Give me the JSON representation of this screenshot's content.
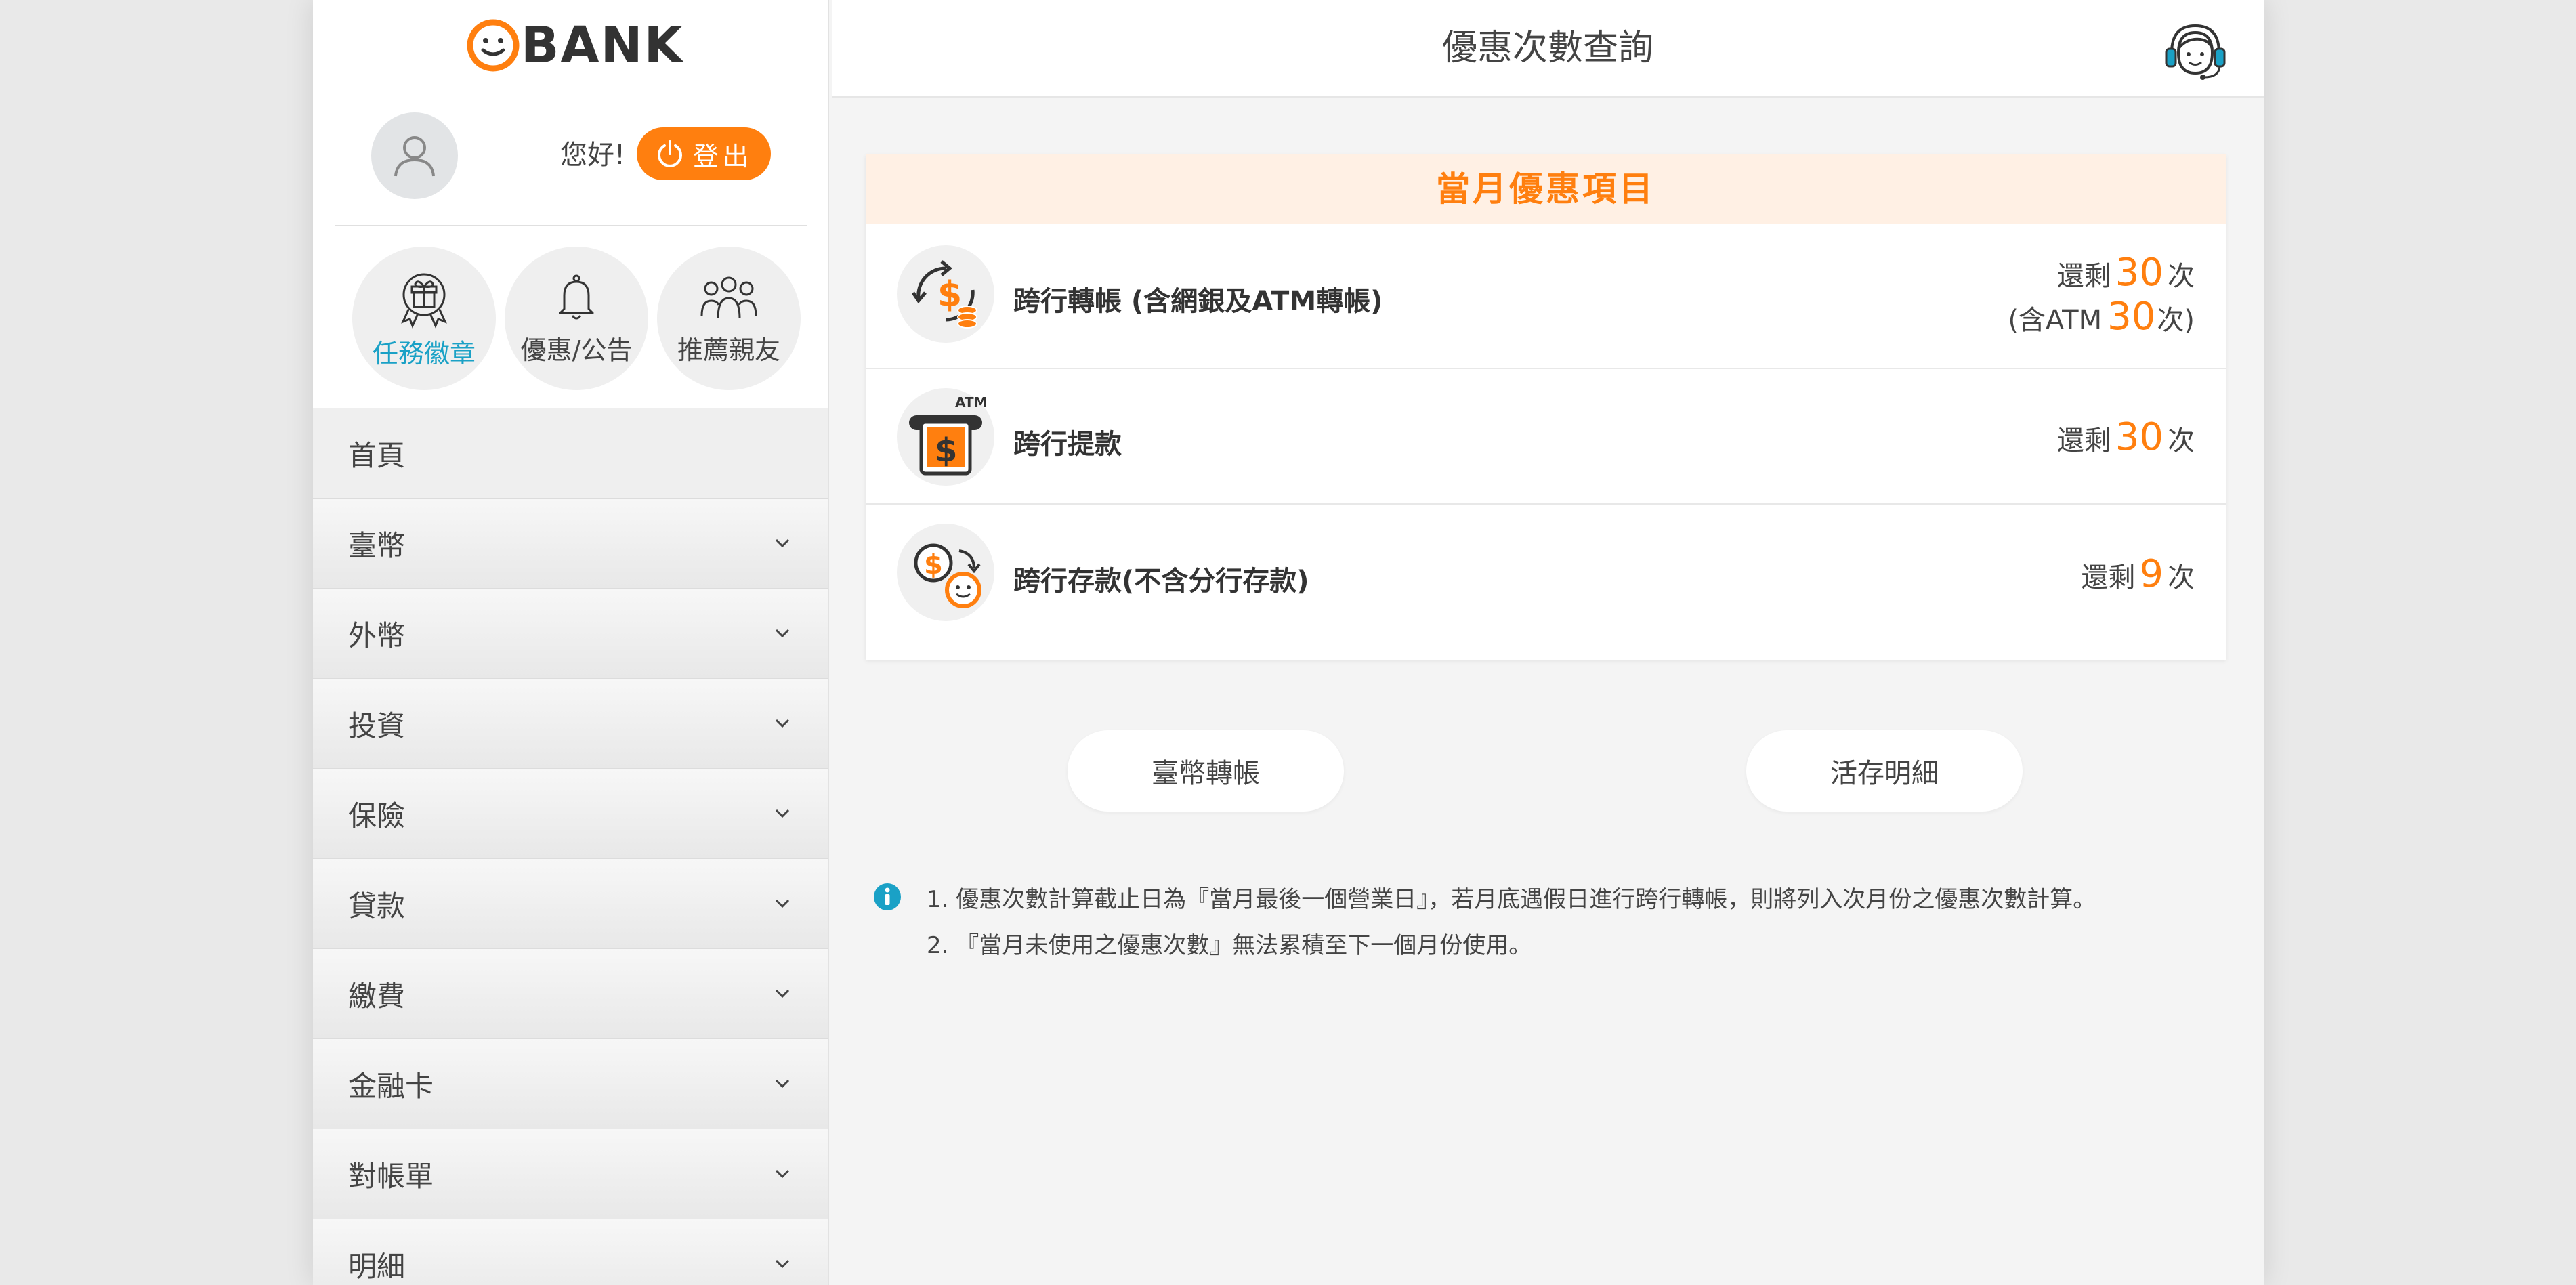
{
  "brand": {
    "logo_text": "BANK",
    "accent": "#ff7f0f",
    "teal": "#1aa1c6"
  },
  "user": {
    "greeting": "您好!",
    "logout_label": "登出"
  },
  "quick_links": [
    {
      "label": "任務徽章",
      "icon": "badge-gift-icon"
    },
    {
      "label": "優惠/公告",
      "icon": "bell-icon"
    },
    {
      "label": "推薦親友",
      "icon": "people-icon"
    }
  ],
  "menu": [
    {
      "label": "首頁"
    },
    {
      "label": "臺幣"
    },
    {
      "label": "外幣"
    },
    {
      "label": "投資"
    },
    {
      "label": "保險"
    },
    {
      "label": "貸款"
    },
    {
      "label": "繳費"
    },
    {
      "label": "金融卡"
    },
    {
      "label": "對帳單"
    },
    {
      "label": "明細"
    }
  ],
  "header": {
    "title": "優惠次數查詢"
  },
  "card": {
    "title": "當月優惠項目",
    "rows": [
      {
        "label": "跨行轉帳 (含網銀及ATM轉帳)",
        "prefix": "還剩",
        "count": "30",
        "suffix": "次",
        "sub_prefix": "(含ATM",
        "sub_count": "30",
        "sub_suffix": "次)"
      },
      {
        "label": "跨行提款",
        "prefix": "還剩",
        "count": "30",
        "suffix": "次"
      },
      {
        "label": "跨行存款(不含分行存款)",
        "prefix": "還剩",
        "count": "9",
        "suffix": "次"
      }
    ],
    "atm_label": "ATM"
  },
  "buttons": {
    "transfer": "臺幣轉帳",
    "details": "活存明細"
  },
  "notes": [
    "1. 優惠次數計算截止日為『當月最後一個營業日』，若月底遇假日進行跨行轉帳，則將列入次月份之優惠次數計算。",
    "2. 『當月未使用之優惠次數』無法累積至下一個月份使用。"
  ]
}
